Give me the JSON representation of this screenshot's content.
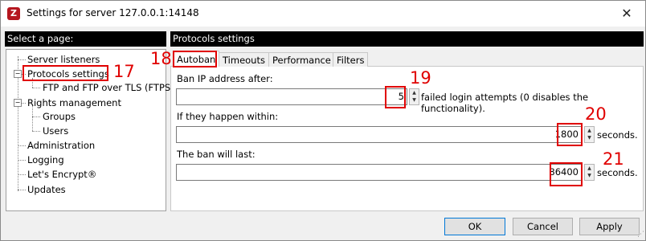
{
  "window": {
    "title": "Settings for server 127.0.0.1:14148",
    "app_icon_letter": "Z",
    "close_glyph": "✕"
  },
  "left_panel": {
    "header": "Select a page:",
    "tree": [
      {
        "label": "Server listeners"
      },
      {
        "label": "Protocols settings",
        "expand": "−"
      },
      {
        "label": "FTP and FTP over TLS (FTPS)"
      },
      {
        "label": "Rights management",
        "expand": "−"
      },
      {
        "label": "Groups"
      },
      {
        "label": "Users"
      },
      {
        "label": "Administration"
      },
      {
        "label": "Logging"
      },
      {
        "label": "Let's Encrypt®"
      },
      {
        "label": "Updates"
      }
    ]
  },
  "right_panel": {
    "header": "Protocols settings",
    "tabs": [
      {
        "label": "Autoban"
      },
      {
        "label": "Timeouts"
      },
      {
        "label": "Performance"
      },
      {
        "label": "Filters"
      }
    ],
    "ban_after": {
      "label": "Ban IP address after:",
      "value": "5",
      "suffix": "failed login attempts (0 disables the functionality)."
    },
    "within": {
      "label": "If they happen within:",
      "value": "1800",
      "suffix": "seconds."
    },
    "duration": {
      "label": "The ban will last:",
      "value": "86400",
      "suffix": "seconds."
    }
  },
  "spinner_glyphs": {
    "up": "▲",
    "down": "▼"
  },
  "annotations": [
    "17",
    "18",
    "19",
    "20",
    "21"
  ],
  "annotation_color": "#e00000",
  "buttons": {
    "ok": "OK",
    "cancel": "Cancel",
    "apply": "Apply"
  },
  "grip_glyph": "⋰"
}
